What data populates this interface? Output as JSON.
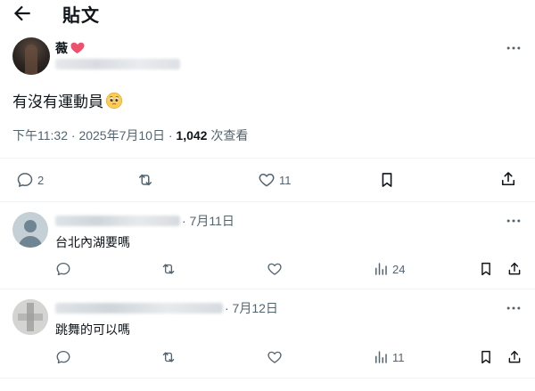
{
  "header": {
    "title": "貼文"
  },
  "post": {
    "author_name": "薇",
    "text": "有沒有運動員",
    "time": "下午11:32",
    "date": "2025年7月10日",
    "sep": "·",
    "views_count": "1,042",
    "views_label": "次查看",
    "actions": {
      "replies": "2",
      "likes": "11"
    }
  },
  "replies": [
    {
      "date": "· 7月11日",
      "text": "台北內湖要嗎",
      "views": "24"
    },
    {
      "date": "· 7月12日",
      "text": "跳舞的可以嗎",
      "views": "11"
    }
  ],
  "colors": {
    "text": "#0f1419",
    "muted": "#536471",
    "divider": "#eff3f4",
    "heart": "#f91880"
  }
}
